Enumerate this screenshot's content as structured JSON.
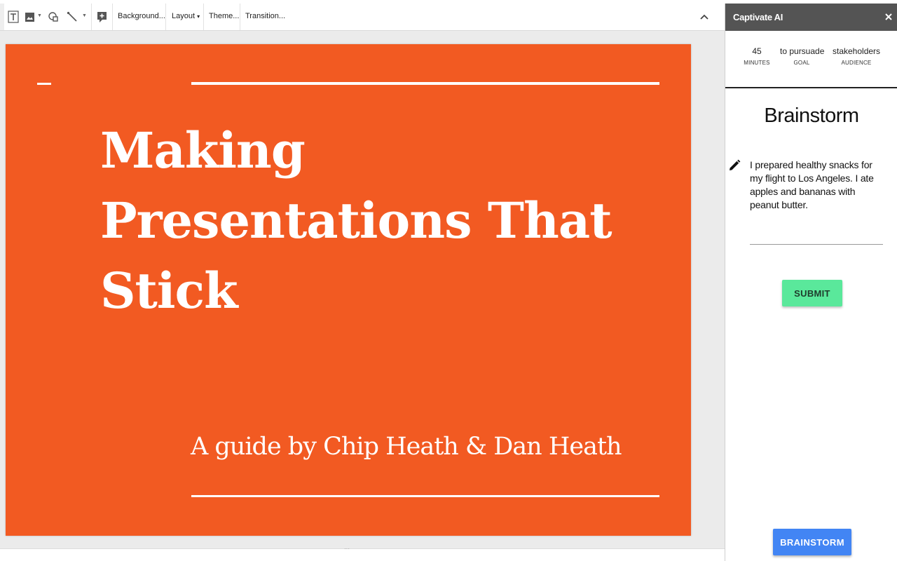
{
  "toolbar": {
    "icons": [
      "text-box-icon",
      "image-icon",
      "shape-icon",
      "line-icon",
      "new-comment-icon",
      "chevron-up-icon"
    ],
    "background_label": "Background...",
    "layout_label": "Layout",
    "layout_caret": "▾",
    "theme_label": "Theme...",
    "transition_label": "Transition..."
  },
  "slide": {
    "background_color": "#f25a22",
    "title_lines": [
      "Making",
      "Presentations That",
      "Stick"
    ],
    "subtitle": "A guide by Chip Heath & Dan Heath"
  },
  "panel": {
    "title": "Captivate AI",
    "stats": [
      {
        "value": "45",
        "label": "MINUTES"
      },
      {
        "value": "to pursuade",
        "label": "GOAL"
      },
      {
        "value": "stakeholders",
        "label": "AUDIENCE"
      }
    ],
    "heading": "Brainstorm",
    "idea_text": "I prepared healthy snacks for my flight to Los Angeles. I ate apples and bananas with peanut butter.",
    "submit_label": "SUBMIT",
    "brainstorm_label": "BRAINSTORM",
    "colors": {
      "header": "#545454",
      "submit": "#5ae89b",
      "brainstorm": "#4285f4"
    }
  }
}
